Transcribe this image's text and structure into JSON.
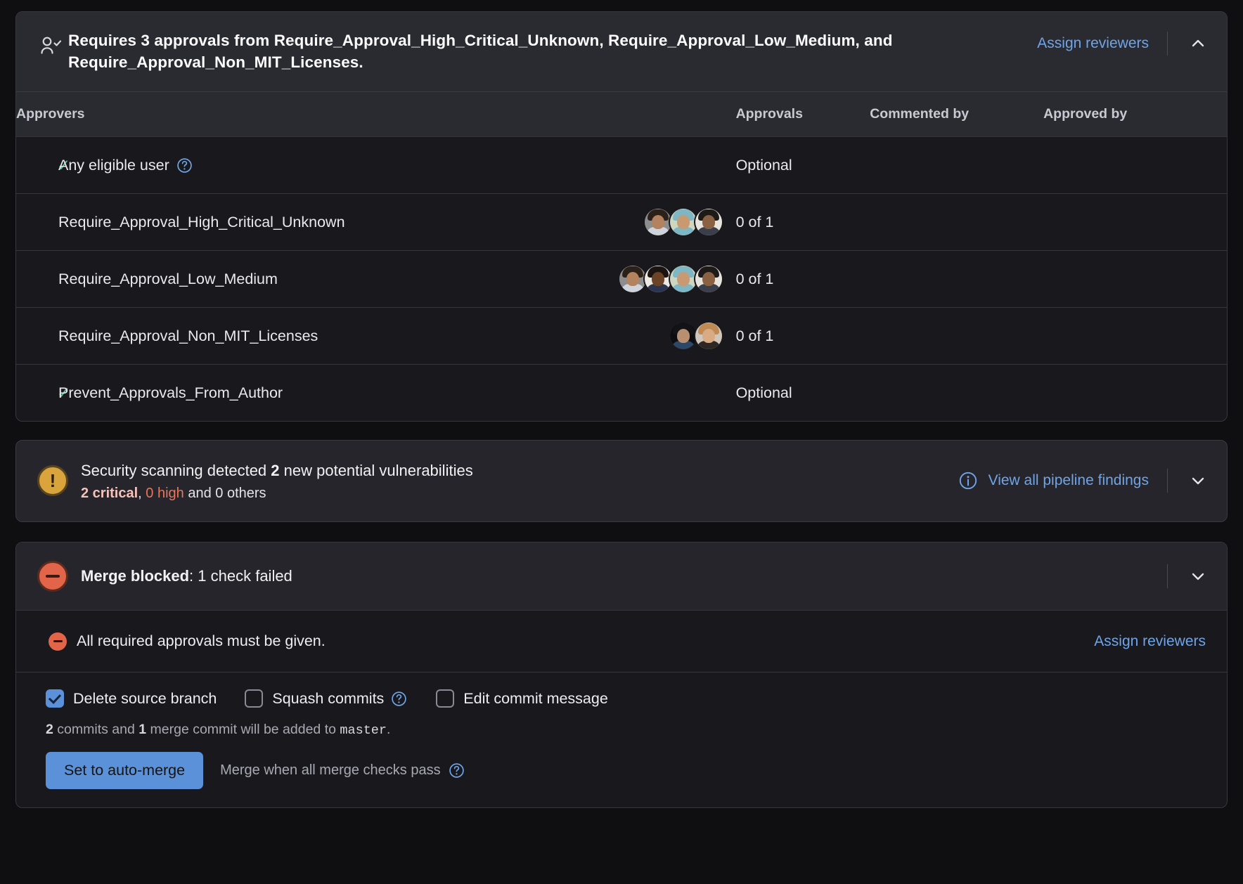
{
  "approvals_panel": {
    "icon": "user-check-icon",
    "title": "Requires 3 approvals from Require_Approval_High_Critical_Unknown, Require_Approval_Low_Medium, and Require_Approval_Non_MIT_Licenses.",
    "assign_reviewers_label": "Assign reviewers",
    "collapse_icon": "chevron-up-icon",
    "columns": {
      "approvers": "Approvers",
      "approvals": "Approvals",
      "commented_by": "Commented by",
      "approved_by": "Approved by"
    },
    "rows": [
      {
        "name": "Any eligible user",
        "has_check": true,
        "has_help": true,
        "approvals": "Optional",
        "avatars": []
      },
      {
        "name": "Require_Approval_High_Critical_Unknown",
        "has_check": false,
        "has_help": false,
        "approvals": "0 of 1",
        "avatars": [
          {
            "hair": "#2b2118",
            "face": "#b3825e",
            "body": "#cfd4dc",
            "bg": "#8d8d8d"
          },
          {
            "hair": "#7fb6c4",
            "face": "#c99a72",
            "body": "#7fb6c4",
            "bg": "#cdd6c0"
          },
          {
            "hair": "#1d1a18",
            "face": "#8a6243",
            "body": "#3a3f4b",
            "bg": "#e7e4de"
          }
        ]
      },
      {
        "name": "Require_Approval_Low_Medium",
        "has_check": false,
        "has_help": false,
        "approvals": "0 of 1",
        "avatars": [
          {
            "hair": "#2b2118",
            "face": "#b3825e",
            "body": "#cfd4dc",
            "bg": "#8d8d8d"
          },
          {
            "hair": "#1b1410",
            "face": "#6b4327",
            "body": "#2b3550",
            "bg": "#ece9e3"
          },
          {
            "hair": "#7fb6c4",
            "face": "#c99a72",
            "body": "#7fb6c4",
            "bg": "#cdd6c0"
          },
          {
            "hair": "#1d1a18",
            "face": "#8a6243",
            "body": "#3a3f4b",
            "bg": "#e7e4de"
          }
        ]
      },
      {
        "name": "Require_Approval_Non_MIT_Licenses",
        "has_check": false,
        "has_help": false,
        "approvals": "0 of 1",
        "avatars": [
          {
            "hair": "#111316",
            "face": "#b98f72",
            "body": "#2d4766",
            "bg": "#0c0d10"
          },
          {
            "hair": "#c08a55",
            "face": "#d8ab85",
            "body": "#2e2723",
            "bg": "#cfc7bb"
          }
        ]
      },
      {
        "name": "Prevent_Approvals_From_Author",
        "has_check": true,
        "has_help": false,
        "approvals": "Optional",
        "avatars": []
      }
    ]
  },
  "security_panel": {
    "badge_icon": "warning-icon",
    "title_prefix": "Security scanning detected ",
    "title_count": "2",
    "title_suffix": " new potential vulnerabilities",
    "critical": "2 critical",
    "high": "0 high",
    "others": " and 0 others",
    "separator": ", ",
    "info_icon": "info-icon",
    "view_findings_label": "View all pipeline findings",
    "expand_icon": "chevron-down-icon"
  },
  "merge_panel": {
    "badge_icon": "blocked-icon",
    "status_bold": "Merge blocked",
    "status_rest": ": 1 check failed",
    "expand_icon": "chevron-down-icon",
    "blocker": {
      "icon": "minus-circle-icon",
      "text": "All required approvals must be given.",
      "assign_reviewers_label": "Assign reviewers"
    },
    "options": [
      {
        "label": "Delete source branch",
        "checked": true,
        "help": false
      },
      {
        "label": "Squash commits",
        "checked": false,
        "help": true
      },
      {
        "label": "Edit commit message",
        "checked": false,
        "help": false
      }
    ],
    "commits_note": {
      "count": "2",
      "mid": " commits and ",
      "merge_count": "1",
      "tail": " merge commit will be added to ",
      "branch": "master",
      "period": "."
    },
    "auto_merge_button": "Set to auto-merge",
    "auto_merge_note": "Merge when all merge checks pass",
    "auto_merge_help_icon": "help-icon"
  },
  "colors": {
    "link": "#6fa5e8",
    "check_green": "#4ec58a",
    "warning": "#d9a43b",
    "blocked": "#e2654a",
    "critical_text": "#f7c3b9",
    "high_text": "#e8765a",
    "primary_button": "#5a91d8"
  }
}
